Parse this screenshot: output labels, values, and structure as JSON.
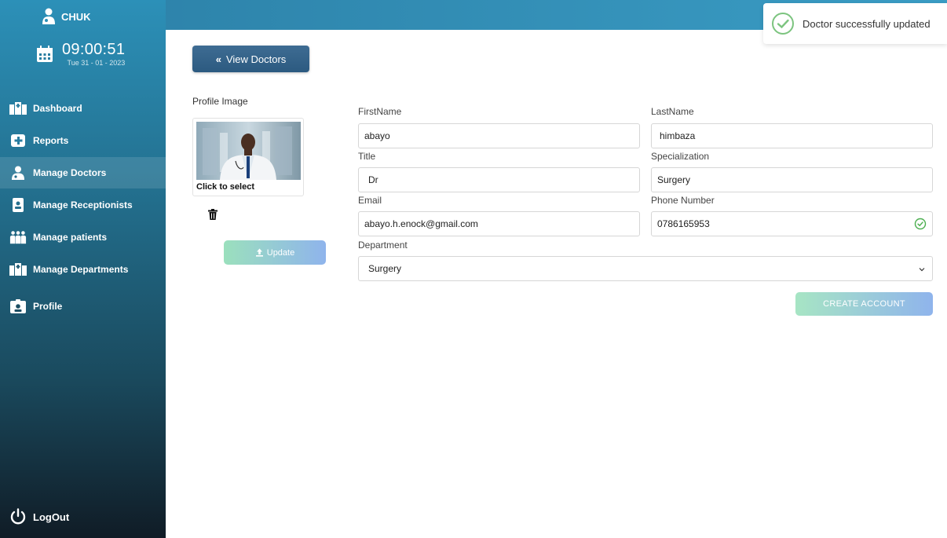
{
  "app": {
    "brand": "CHUK"
  },
  "clock": {
    "time": "09:00:51",
    "date": "Tue 31 - 01 - 2023"
  },
  "sidebar": {
    "items": [
      {
        "label": "Dashboard",
        "icon": "hospital-icon"
      },
      {
        "label": "Reports",
        "icon": "medical-report-icon"
      },
      {
        "label": "Manage Doctors",
        "icon": "doctor-icon",
        "active": true
      },
      {
        "label": "Manage Receptionists",
        "icon": "id-badge-icon"
      },
      {
        "label": "Manage patients",
        "icon": "people-group-icon"
      },
      {
        "label": "Manage Departments",
        "icon": "hospital-icon"
      },
      {
        "label": "Profile",
        "icon": "id-card-icon"
      }
    ],
    "logout": "LogOut"
  },
  "main": {
    "view_doctors_label": "View Doctors",
    "profile_image_label": "Profile Image",
    "click_to_select": "Click to select",
    "update_label": "Update",
    "create_account_label": "CREATE ACCOUNT"
  },
  "form": {
    "firstname": {
      "label": "FirstName",
      "value": "abayo"
    },
    "lastname": {
      "label": "LastName",
      "value": "himbaza"
    },
    "title": {
      "label": "Title",
      "value": "Dr"
    },
    "specialization": {
      "label": "Specialization",
      "value": "Surgery"
    },
    "email": {
      "label": "Email",
      "value": "abayo.h.enock@gmail.com"
    },
    "phone": {
      "label": "Phone Number",
      "value": "0786165953"
    },
    "department": {
      "label": "Department",
      "value": "Surgery"
    }
  },
  "toast": {
    "message": "Doctor successfully updated"
  },
  "colors": {
    "accent": "#3a9cc4",
    "sidebar_dark": "#101c26",
    "success": "#5cb85c",
    "button_dark": "#2c5a80"
  }
}
